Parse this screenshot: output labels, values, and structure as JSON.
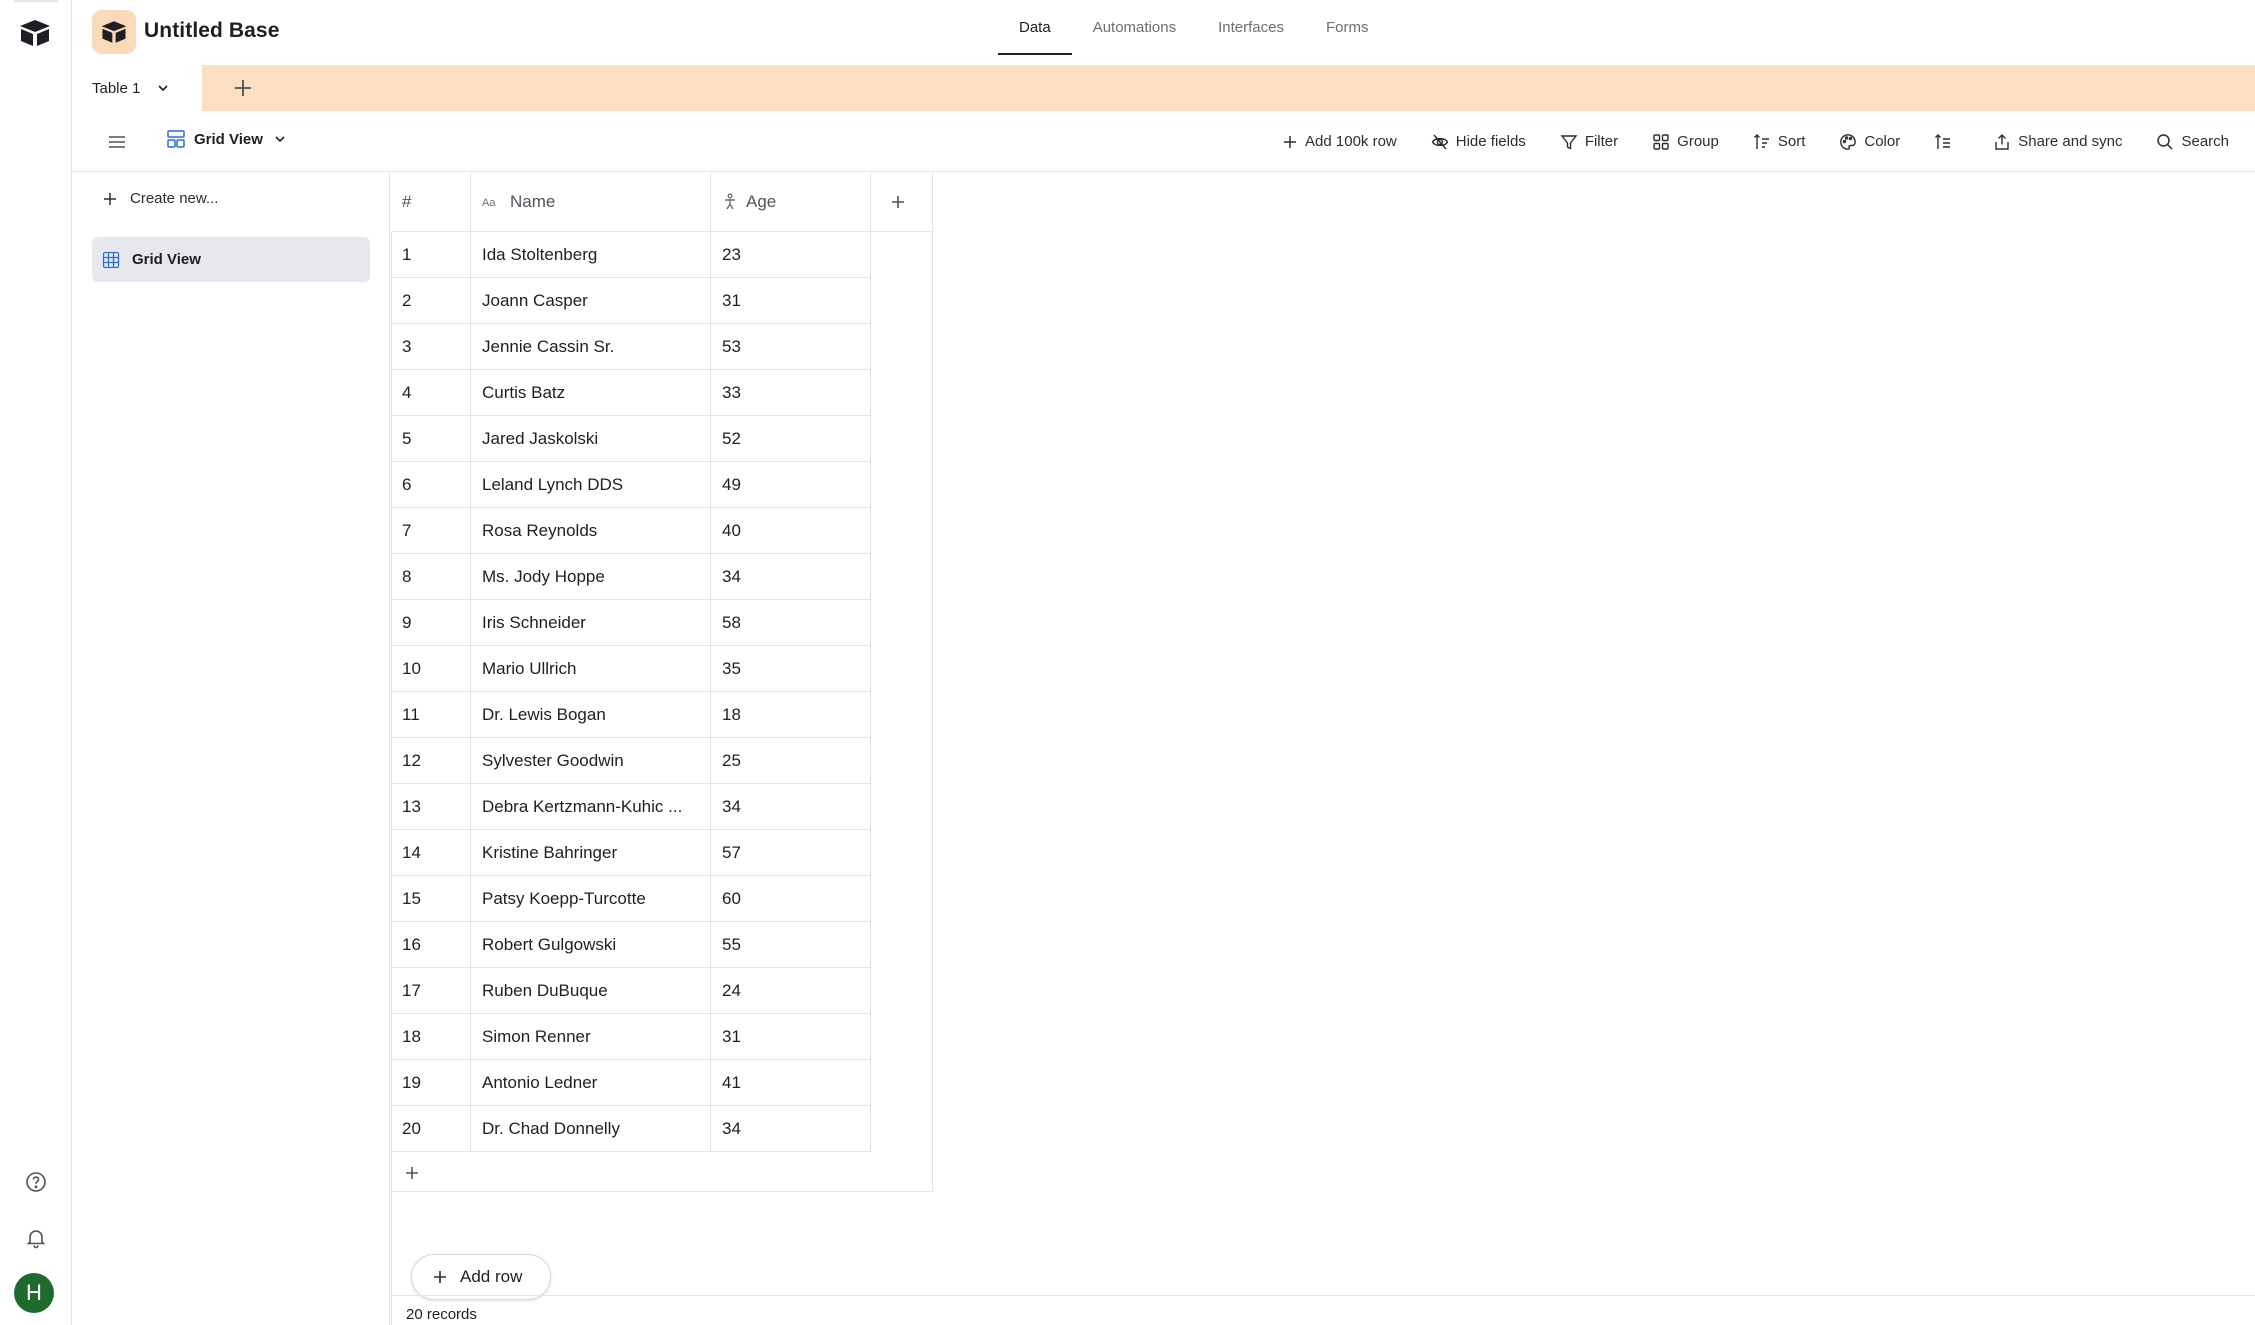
{
  "base": {
    "title": "Untitled Base"
  },
  "nav": {
    "tabs": [
      {
        "label": "Data",
        "active": true
      },
      {
        "label": "Automations"
      },
      {
        "label": "Interfaces"
      },
      {
        "label": "Forms"
      }
    ]
  },
  "table_tabs": {
    "current": "Table 1"
  },
  "toolbar": {
    "view_name": "Grid View",
    "add_100k": "Add 100k row",
    "hide_fields": "Hide fields",
    "filter": "Filter",
    "group": "Group",
    "sort": "Sort",
    "color": "Color",
    "share": "Share and sync",
    "search": "Search"
  },
  "sidebar": {
    "create_new": "Create new...",
    "views": [
      {
        "label": "Grid View",
        "selected": true
      }
    ]
  },
  "grid": {
    "columns": {
      "num": "#",
      "name": "Name",
      "age": "Age"
    },
    "rows": [
      {
        "n": "1",
        "name": "Ida Stoltenberg",
        "age": "23"
      },
      {
        "n": "2",
        "name": "Joann Casper",
        "age": "31"
      },
      {
        "n": "3",
        "name": "Jennie Cassin Sr.",
        "age": "53"
      },
      {
        "n": "4",
        "name": "Curtis Batz",
        "age": "33"
      },
      {
        "n": "5",
        "name": "Jared Jaskolski",
        "age": "52"
      },
      {
        "n": "6",
        "name": "Leland Lynch DDS",
        "age": "49"
      },
      {
        "n": "7",
        "name": "Rosa Reynolds",
        "age": "40"
      },
      {
        "n": "8",
        "name": "Ms. Jody Hoppe",
        "age": "34"
      },
      {
        "n": "9",
        "name": "Iris Schneider",
        "age": "58"
      },
      {
        "n": "10",
        "name": "Mario Ullrich",
        "age": "35"
      },
      {
        "n": "11",
        "name": "Dr. Lewis Bogan",
        "age": "18"
      },
      {
        "n": "12",
        "name": "Sylvester Goodwin",
        "age": "25"
      },
      {
        "n": "13",
        "name": "Debra Kertzmann-Kuhic ...",
        "age": "34"
      },
      {
        "n": "14",
        "name": "Kristine Bahringer",
        "age": "57"
      },
      {
        "n": "15",
        "name": "Patsy Koepp-Turcotte",
        "age": "60"
      },
      {
        "n": "16",
        "name": "Robert Gulgowski",
        "age": "55"
      },
      {
        "n": "17",
        "name": "Ruben DuBuque",
        "age": "24"
      },
      {
        "n": "18",
        "name": "Simon Renner",
        "age": "31"
      },
      {
        "n": "19",
        "name": "Antonio Ledner",
        "age": "41"
      },
      {
        "n": "20",
        "name": "Dr. Chad Donnelly",
        "age": "34"
      }
    ]
  },
  "footer": {
    "add_row": "Add row",
    "records": "20 records"
  },
  "user": {
    "initial": "H"
  },
  "colors": {
    "accent": "#fde0c2",
    "avatar": "#1f6b2e",
    "selected_view": "#e6e8ec"
  }
}
